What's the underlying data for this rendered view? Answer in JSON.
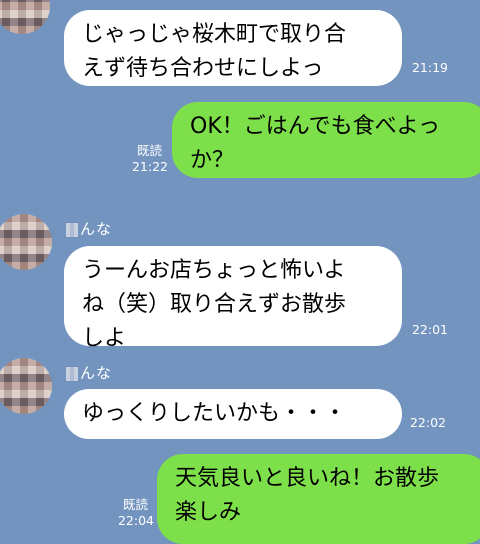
{
  "chat": {
    "messages": [
      {
        "id": "m1",
        "side": "in",
        "text": "じゃっじゃ桜木町で取り合\nえず待ち合わせにしよっ",
        "time": "21:19"
      },
      {
        "id": "m2",
        "side": "out",
        "text": "OK！ごはんでも食べよっ\nか？",
        "time": "21:22",
        "read": "既読"
      },
      {
        "id": "m3",
        "side": "in",
        "sender": "んな",
        "text": "うーんお店ちょっと怖いよ\nね（笑）取り合えずお散歩\nしよ",
        "time": "22:01"
      },
      {
        "id": "m4",
        "side": "in",
        "sender": "んな",
        "text": "ゆっくりしたいかも・・・",
        "time": "22:02"
      },
      {
        "id": "m5",
        "side": "out",
        "text": "天気良いと良いね！お散歩\n楽しみ",
        "time": "22:04",
        "read": "既読"
      }
    ]
  },
  "colors": {
    "background": "#7494c0",
    "incoming_bubble": "#ffffff",
    "outgoing_bubble": "#7de04a"
  }
}
